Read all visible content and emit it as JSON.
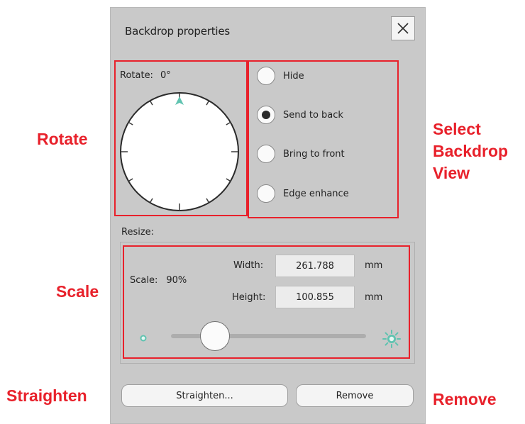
{
  "dialog": {
    "title": "Backdrop properties",
    "close_icon": "close-icon"
  },
  "rotate": {
    "label": "Rotate:",
    "value": "0°",
    "dial_icon": "rotation-dial"
  },
  "view_options": [
    {
      "label": "Hide",
      "selected": false
    },
    {
      "label": "Send to back",
      "selected": true
    },
    {
      "label": "Bring to front",
      "selected": false
    },
    {
      "label": "Edge enhance",
      "selected": false
    }
  ],
  "resize": {
    "label": "Resize:",
    "scale_label": "Scale:",
    "scale_value": "90%",
    "width_label": "Width:",
    "width_value": "261.788",
    "width_unit": "mm",
    "height_label": "Height:",
    "height_value": "100.855",
    "height_unit": "mm",
    "slider_level": 0.15,
    "slider_min_icon": "small-sun-icon",
    "slider_max_icon": "large-sun-icon"
  },
  "buttons": {
    "straighten": "Straighten...",
    "remove": "Remove"
  },
  "annotations": {
    "rotate": "Rotate",
    "select_view": [
      "Select",
      "Backdrop",
      "View"
    ],
    "scale": "Scale",
    "straighten": "Straighten",
    "remove": "Remove"
  },
  "colors": {
    "highlight": "#e8212b",
    "panel_bg": "#c9c9c9",
    "dial_marker": "#5fc3b0"
  }
}
